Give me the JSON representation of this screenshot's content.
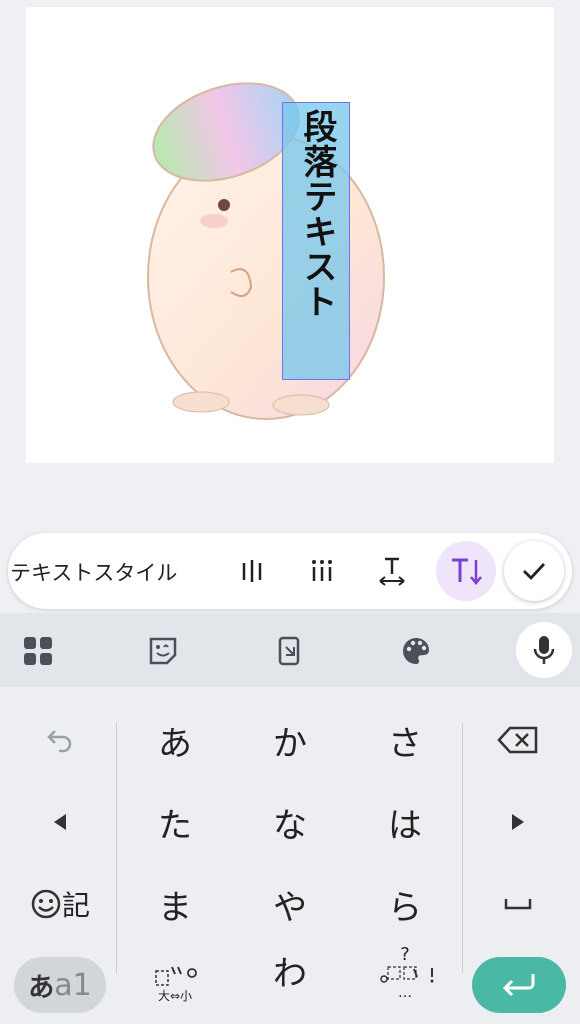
{
  "canvas": {
    "text_content": "段落テキスト"
  },
  "toolbar": {
    "label": "テキストスタイル",
    "buttons": [
      "line-spacing-icon",
      "letter-spacing-icon",
      "text-resize-icon",
      "vertical-text-icon"
    ],
    "active_color": "#7a3fd1"
  },
  "keyboard": {
    "toolbar_icons": [
      "apps-grid-icon",
      "sticker-icon",
      "clipboard-icon",
      "palette-icon",
      "mic-icon"
    ],
    "rows": [
      [
        "あ",
        "か",
        "さ"
      ],
      [
        "た",
        "な",
        "は"
      ],
      [
        "ま",
        "や",
        "ら"
      ],
      [
        "",
        "わ",
        ""
      ]
    ],
    "emoji_label": "記",
    "mode_label_hira": "あ",
    "mode_label_alpha": "a1",
    "dakuten_bottom": "大⇔小",
    "punct_top": "?",
    "punct_bottom": "…",
    "accent": "#49b8a5"
  }
}
